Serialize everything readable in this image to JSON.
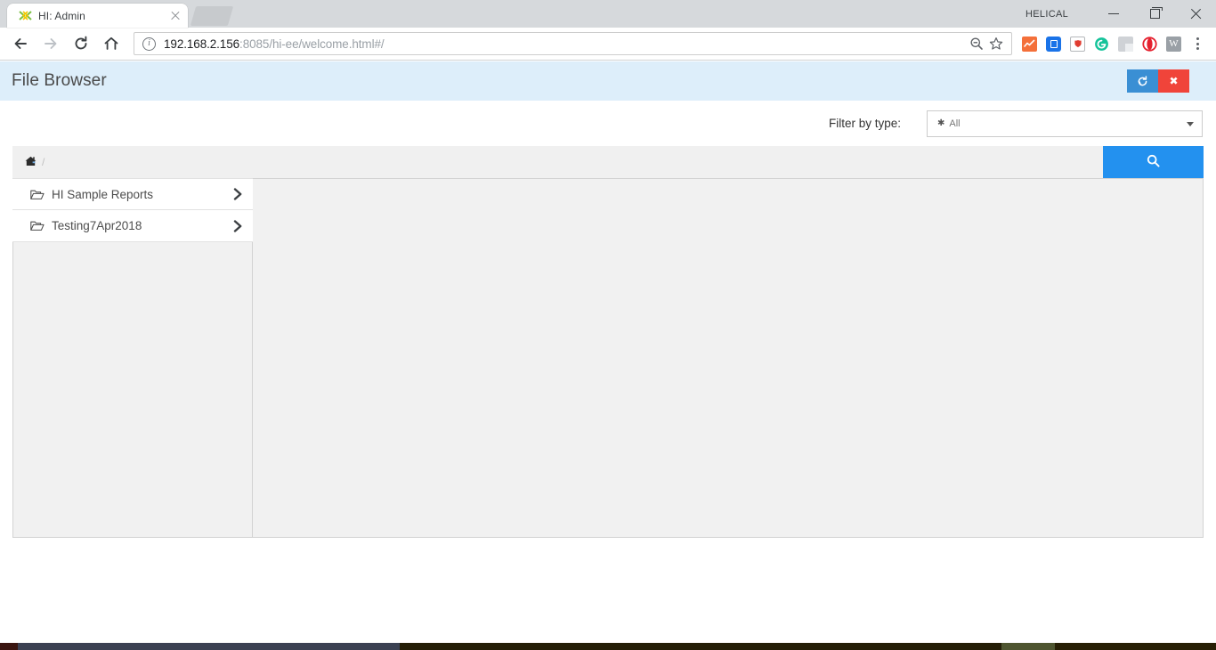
{
  "browser": {
    "tab": {
      "title": "HI: Admin",
      "favicon_icon": "dna-helix-icon",
      "close_icon": "close-icon"
    },
    "new_tab_icon": "new-tab-icon",
    "window": {
      "profile_label": "HELICAL",
      "minimize_icon": "minimize-icon",
      "maximize_icon": "maximize-icon",
      "close_icon": "window-close-icon"
    },
    "toolbar": {
      "back_icon": "back-arrow-icon",
      "forward_icon": "forward-arrow-icon",
      "reload_icon": "reload-icon",
      "home_icon": "home-icon",
      "security_icon": "info-circle-icon",
      "url_host": "192.168.2.156",
      "url_rest": ":8085/hi-ee/welcome.html#/",
      "zoom_out_icon": "zoom-out-icon",
      "bookmark_icon": "star-icon",
      "menu_icon": "three-dots-menu-icon",
      "extensions": [
        {
          "name": "chart-extension-icon",
          "color": "#f4703a"
        },
        {
          "name": "bluetooth-extension-icon",
          "color": "#1a73e8"
        },
        {
          "name": "shield-extension-icon",
          "color": "#e03c31"
        },
        {
          "name": "grammarly-extension-icon",
          "color": "#15c39a"
        },
        {
          "name": "generic-extension-icon",
          "color": "#cfd2d6"
        },
        {
          "name": "opera-extension-icon",
          "color": "#e5202e"
        },
        {
          "name": "wikipedia-extension-icon",
          "color": "#9aa0a6"
        }
      ]
    }
  },
  "app": {
    "title": "File Browser",
    "header_actions": {
      "refresh_label": "↻",
      "refresh_icon": "refresh-icon",
      "close_label": "✖",
      "close_icon": "close-icon"
    },
    "filter": {
      "label": "Filter by type:",
      "star_glyph": "✱",
      "selected_value": "All",
      "options": [
        "All"
      ],
      "caret_icon": "chevron-down-icon"
    },
    "search": {
      "home_glyph": "⌂",
      "home_icon": "home-icon",
      "separator": "/",
      "path_value": "",
      "placeholder": "",
      "button_icon": "search-icon"
    },
    "folders": [
      {
        "name": "HI Sample Reports",
        "icon": "open-folder-icon",
        "chevron": "chevron-right-icon"
      },
      {
        "name": "Testing7Apr2018",
        "icon": "open-folder-icon",
        "chevron": "chevron-right-icon"
      }
    ],
    "colors": {
      "header_bg": "#ddeefa",
      "refresh_btn": "#3a8fd4",
      "close_btn": "#f0443a",
      "search_btn": "#2391ef",
      "pane_bg": "#f1f1f1",
      "breadcrumb_bg": "#f0f0f0"
    }
  }
}
